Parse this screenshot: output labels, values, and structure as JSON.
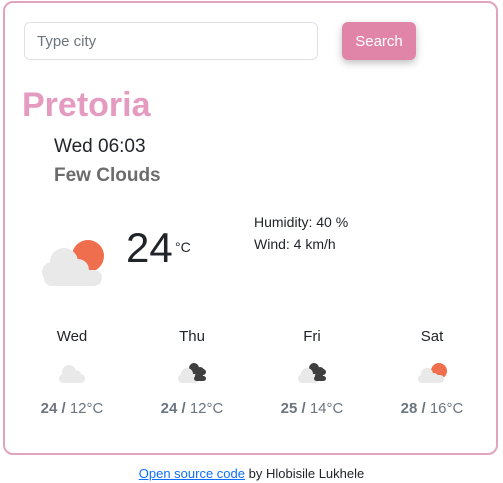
{
  "search": {
    "placeholder": "Type city",
    "button_label": "Search"
  },
  "current": {
    "city": "Pretoria",
    "datetime": "Wed 06:03",
    "description": "Few Clouds",
    "temperature": "24",
    "unit": "°C",
    "humidity_label": "Humidity: 40 %",
    "wind_label": "Wind: 4 km/h",
    "icon": "few-clouds-day-icon"
  },
  "forecast": [
    {
      "day": "Wed",
      "max": "24",
      "sep": "/",
      "min": "12°C",
      "icon": "cloud-icon"
    },
    {
      "day": "Thu",
      "max": "24",
      "sep": "/",
      "min": "12°C",
      "icon": "broken-clouds-icon"
    },
    {
      "day": "Fri",
      "max": "25",
      "sep": "/",
      "min": "14°C",
      "icon": "broken-clouds-icon"
    },
    {
      "day": "Sat",
      "max": "28",
      "sep": "/",
      "min": "16°C",
      "icon": "few-clouds-day-icon"
    }
  ],
  "footer": {
    "link_text": "Open source code",
    "suffix": " by Hlobisile Lukhele"
  },
  "colors": {
    "accent": "#e085a8",
    "city": "#e59ac0",
    "border": "#e0a3c0",
    "sun": "#ee6e4e",
    "cloud": "#e9e9e9",
    "dark_cloud": "#3f3f3f"
  }
}
